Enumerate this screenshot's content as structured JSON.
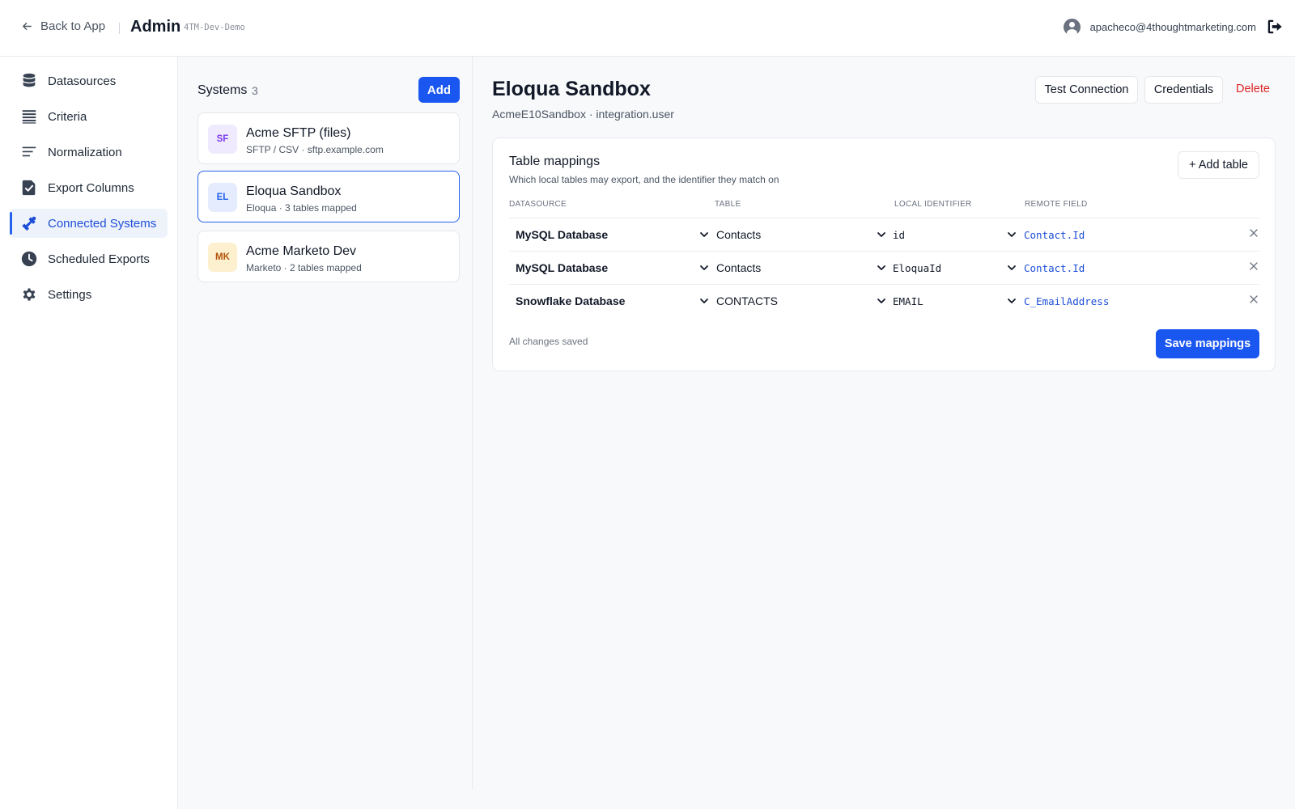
{
  "header": {
    "back_label": "Back to App",
    "title": "Admin",
    "environment": "4TM-Dev-Demo",
    "user_email": "apacheco@4thoughtmarketing.com"
  },
  "sidebar": {
    "items": [
      {
        "label": "Datasources",
        "icon": "database-icon"
      },
      {
        "label": "Criteria",
        "icon": "list-icon"
      },
      {
        "label": "Normalization",
        "icon": "lines-icon"
      },
      {
        "label": "Export Columns",
        "icon": "checklist-icon"
      },
      {
        "label": "Connected Systems",
        "icon": "plug-icon",
        "active": true
      },
      {
        "label": "Scheduled Exports",
        "icon": "clock-icon"
      },
      {
        "label": "Settings",
        "icon": "gear-icon"
      }
    ]
  },
  "systems": {
    "heading": "Systems",
    "count": "3",
    "add_label": "Add",
    "cards": [
      {
        "badge": "SF",
        "title": "Acme SFTP (files)",
        "subtitle": "SFTP / CSV · sftp.example.com",
        "badge_bg": "#efeafd",
        "badge_fg": "#7c3aed"
      },
      {
        "badge": "EL",
        "title": "Eloqua Sandbox",
        "subtitle": "Eloqua · 3 tables mapped",
        "badge_bg": "#e4ecfd",
        "badge_fg": "#2563eb",
        "selected": true
      },
      {
        "badge": "MK",
        "title": "Acme Marketo Dev",
        "subtitle": "Marketo · 2 tables mapped",
        "badge_bg": "#fdf0cf",
        "badge_fg": "#b45309"
      }
    ]
  },
  "detail": {
    "title": "Eloqua Sandbox",
    "subtitle": "AcmeE10Sandbox · integration.user",
    "test_connection_label": "Test Connection",
    "credentials_label": "Credentials",
    "delete_label": "Delete"
  },
  "mappings": {
    "title": "Table mappings",
    "subtitle": "Which local tables may export, and the identifier they match on",
    "add_table_label": "+ Add table",
    "columns": [
      "DATASOURCE",
      "TABLE",
      "LOCAL IDENTIFIER",
      "REMOTE FIELD"
    ],
    "rows": [
      {
        "datasource": "MySQL Database",
        "table": "Contacts",
        "local_identifier": "id",
        "remote_field": "Contact.Id"
      },
      {
        "datasource": "MySQL Database",
        "table": "Contacts",
        "local_identifier": "EloquaId",
        "remote_field": "Contact.Id"
      },
      {
        "datasource": "Snowflake Database",
        "table": "CONTACTS",
        "local_identifier": "EMAIL",
        "remote_field": "C_EmailAddress"
      }
    ],
    "status": "All changes saved",
    "save_label": "Save mappings"
  },
  "colors": {
    "accent": "#1a56f0",
    "danger": "#dc2626",
    "active_nav_bg": "#eef2fb"
  }
}
